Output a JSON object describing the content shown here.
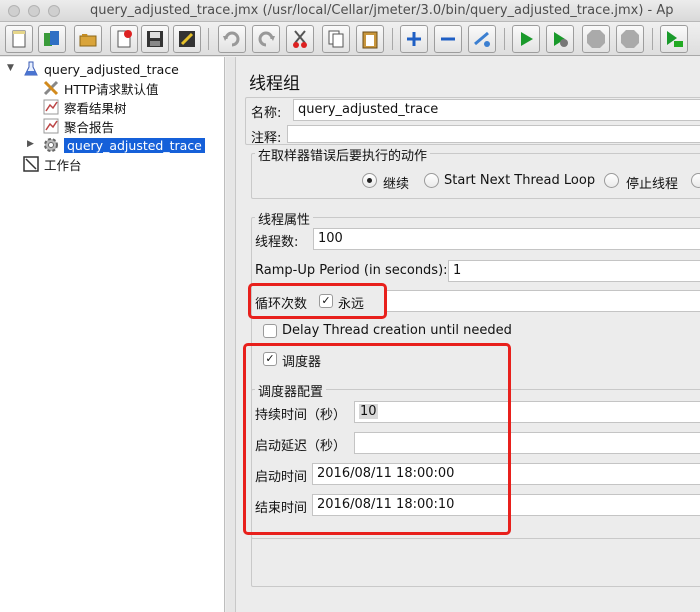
{
  "window": {
    "title": "query_adjusted_trace.jmx (/usr/local/Cellar/jmeter/3.0/bin/query_adjusted_trace.jmx) - Ap"
  },
  "toolbar": {
    "buttons": [
      "new-icon",
      "templates-icon",
      "open-icon",
      "close-icon",
      "save-icon",
      "save-as-icon",
      "undo-icon",
      "redo-icon",
      "cut-icon",
      "copy-icon",
      "paste-icon",
      "expand-icon",
      "collapse-icon",
      "toggle-icon",
      "start-icon",
      "start-no-pause-icon",
      "stop-icon",
      "shutdown-icon",
      "remote-start-icon"
    ]
  },
  "tree": {
    "root": "query_adjusted_trace",
    "items": [
      {
        "label": "HTTP请求默认值",
        "icon": "wrench-icon"
      },
      {
        "label": "察看结果树",
        "icon": "listener-icon"
      },
      {
        "label": "聚合报告",
        "icon": "listener-icon"
      },
      {
        "label": "query_adjusted_trace",
        "icon": "gear-icon",
        "selected": true
      }
    ],
    "workbench": "工作台"
  },
  "panel": {
    "heading": "线程组",
    "name_label": "名称:",
    "name_value": "query_adjusted_trace",
    "comment_label": "注释:",
    "comment_value": "",
    "on_error": {
      "title": "在取样器错误后要执行的动作",
      "options": [
        "继续",
        "Start Next Thread Loop",
        "停止线程"
      ],
      "selected": "继续"
    },
    "thread_props": {
      "title": "线程属性",
      "threads_label": "线程数:",
      "threads_value": "100",
      "rampup_label": "Ramp-Up Period (in seconds):",
      "rampup_value": "1",
      "loop_label": "循环次数",
      "forever_label": "永远",
      "forever_checked": true,
      "delay_label": "Delay Thread creation until needed",
      "delay_checked": false
    },
    "scheduler": {
      "label": "调度器",
      "checked": true,
      "config_title": "调度器配置",
      "duration_label": "持续时间（秒）",
      "duration_value": "10",
      "delay_label": "启动延迟（秒）",
      "delay_value": "",
      "start_label": "启动时间",
      "start_value": "2016/08/11 18:00:00",
      "end_label": "结束时间",
      "end_value": "2016/08/11 18:00:10"
    }
  },
  "colors": {
    "highlight": "#e8201c",
    "selection": "#1560d9"
  }
}
